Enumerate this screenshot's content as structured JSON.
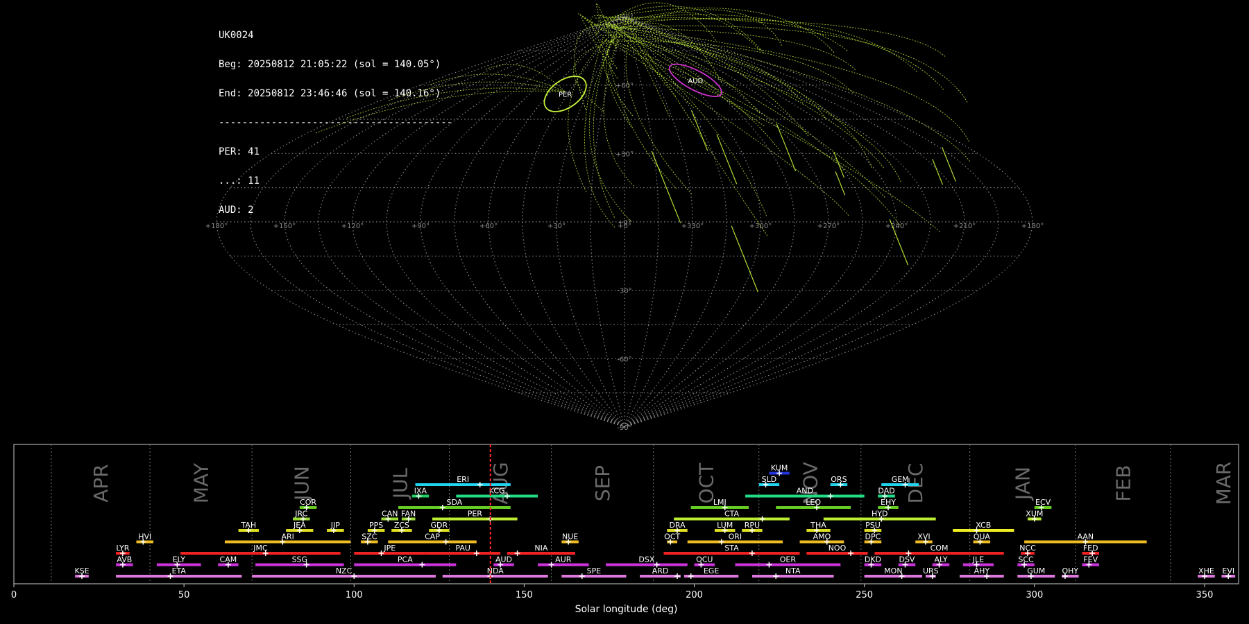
{
  "info": {
    "camera": "UK0024",
    "begin": "Beg: 20250812 21:05:22 (sol = 140.05°)",
    "end": "End: 20250812 23:46:46 (sol = 140.16°)",
    "separator": "----------------------------------------",
    "counts": [
      "PER: 41",
      "...: 11",
      "AUD: 2"
    ]
  },
  "colors": {
    "background": "#000000",
    "meteor_trail": "#c8f53c",
    "per_radiant": "#c8f53c",
    "aud_radiant": "#cc33cc",
    "grid": "#9a9a9a",
    "current_sol": "#ff2222"
  },
  "chart_data": [
    {
      "type": "scatter",
      "projection": "sinusoidal",
      "description_labels": {
        "lat_ticks": [
          "+90°",
          "+60°",
          "+30°",
          "+0°",
          "-30°",
          "-60°",
          "-90°"
        ],
        "lon_ticks": [
          "+180°",
          "+150°",
          "+120°",
          "+90°",
          "+60°",
          "+30°",
          "+0°",
          "+330°",
          "+300°",
          "+270°",
          "+240°",
          "+210°",
          "+180°"
        ]
      },
      "radiants": [
        {
          "name": "PER",
          "lon": 48,
          "lat": 57,
          "color": "#c8f53c",
          "count": 41
        },
        {
          "name": "AUD",
          "lon": 291,
          "lat": 63,
          "color": "#cc33cc",
          "count": 2
        }
      ],
      "trails_color": "#c8f53c",
      "grid": true
    },
    {
      "type": "gantt",
      "xlabel": "Solar longitude (deg)",
      "xlim": [
        0,
        360
      ],
      "xticks": [
        0,
        50,
        100,
        150,
        200,
        250,
        300,
        350
      ],
      "current_sol": 140.1,
      "months": [
        {
          "label": "APR",
          "start": 11
        },
        {
          "label": "MAY",
          "start": 40
        },
        {
          "label": "JUN",
          "start": 70
        },
        {
          "label": "JUL",
          "start": 99
        },
        {
          "label": "AUG",
          "start": 128
        },
        {
          "label": "SEP",
          "start": 158
        },
        {
          "label": "OCT",
          "start": 188
        },
        {
          "label": "NOV",
          "start": 219
        },
        {
          "label": "DEC",
          "start": 249
        },
        {
          "label": "JAN",
          "start": 281
        },
        {
          "label": "FEB",
          "start": 312
        },
        {
          "label": "MAR",
          "start": 340
        }
      ],
      "showers": [
        {
          "code": "KUM",
          "start": 222,
          "end": 228,
          "peak": 225,
          "row": 9,
          "color": "#2233dd"
        },
        {
          "code": "ERI",
          "start": 118,
          "end": 146,
          "peak": 137,
          "row": 8,
          "color": "#22d3ee"
        },
        {
          "code": "SLD",
          "start": 219,
          "end": 225,
          "peak": 221,
          "row": 8,
          "color": "#22d3ee"
        },
        {
          "code": "ORS",
          "start": 240,
          "end": 245,
          "peak": 243,
          "row": 8,
          "color": "#22d3ee"
        },
        {
          "code": "GEM",
          "start": 255,
          "end": 266,
          "peak": 262,
          "row": 8,
          "color": "#22d3ee"
        },
        {
          "code": "IXA",
          "start": 117,
          "end": 122,
          "peak": 119,
          "row": 7,
          "color": "#22cc66"
        },
        {
          "code": "KCG",
          "start": 130,
          "end": 154,
          "peak": 145,
          "row": 7,
          "color": "#22dd88"
        },
        {
          "code": "AND",
          "start": 215,
          "end": 250,
          "peak": 240,
          "row": 7,
          "color": "#22dd88"
        },
        {
          "code": "DAD",
          "start": 254,
          "end": 259,
          "peak": 256,
          "row": 7,
          "color": "#22dd88"
        },
        {
          "code": "COR",
          "start": 84,
          "end": 89,
          "peak": 86,
          "row": 6,
          "color": "#66cc22"
        },
        {
          "code": "SDA",
          "start": 113,
          "end": 146,
          "peak": 126,
          "row": 6,
          "color": "#66cc22"
        },
        {
          "code": "LMI",
          "start": 199,
          "end": 216,
          "peak": 209,
          "row": 6,
          "color": "#66cc22"
        },
        {
          "code": "LEO",
          "start": 224,
          "end": 246,
          "peak": 236,
          "row": 6,
          "color": "#66cc22"
        },
        {
          "code": "EHY",
          "start": 254,
          "end": 260,
          "peak": 257,
          "row": 6,
          "color": "#66cc22"
        },
        {
          "code": "ECV",
          "start": 300,
          "end": 305,
          "peak": 302,
          "row": 6,
          "color": "#66cc22"
        },
        {
          "code": "JRC",
          "start": 82,
          "end": 87,
          "peak": 85,
          "row": 5,
          "color": "#99dd33"
        },
        {
          "code": "CAN",
          "start": 108,
          "end": 113,
          "peak": 110,
          "row": 5,
          "color": "#99dd33"
        },
        {
          "code": "FAN",
          "start": 114,
          "end": 118,
          "peak": 116,
          "row": 5,
          "color": "#99dd33"
        },
        {
          "code": "PER",
          "start": 123,
          "end": 148,
          "peak": 140,
          "row": 5,
          "color": "#bbee33"
        },
        {
          "code": "CTA",
          "start": 194,
          "end": 228,
          "peak": 220,
          "row": 5,
          "color": "#bbee33"
        },
        {
          "code": "HYD",
          "start": 238,
          "end": 271,
          "peak": 255,
          "row": 5,
          "color": "#bbee33"
        },
        {
          "code": "XUM",
          "start": 298,
          "end": 302,
          "peak": 300,
          "row": 5,
          "color": "#bbee33"
        },
        {
          "code": "TAH",
          "start": 66,
          "end": 72,
          "peak": 69,
          "row": 4,
          "color": "#dddd22"
        },
        {
          "code": "JEA",
          "start": 80,
          "end": 88,
          "peak": 84,
          "row": 4,
          "color": "#dddd22"
        },
        {
          "code": "JIP",
          "start": 92,
          "end": 97,
          "peak": 94,
          "row": 4,
          "color": "#dddd22"
        },
        {
          "code": "PPS",
          "start": 104,
          "end": 109,
          "peak": 106,
          "row": 4,
          "color": "#dddd22"
        },
        {
          "code": "ZCS",
          "start": 111,
          "end": 117,
          "peak": 114,
          "row": 4,
          "color": "#dddd22"
        },
        {
          "code": "GDR",
          "start": 122,
          "end": 128,
          "peak": 125,
          "row": 4,
          "color": "#dddd22"
        },
        {
          "code": "DRA",
          "start": 192,
          "end": 198,
          "peak": 195,
          "row": 4,
          "color": "#dddd22"
        },
        {
          "code": "LUM",
          "start": 206,
          "end": 212,
          "peak": 209,
          "row": 4,
          "color": "#dddd22"
        },
        {
          "code": "RPU",
          "start": 214,
          "end": 220,
          "peak": 217,
          "row": 4,
          "color": "#dddd22"
        },
        {
          "code": "THA",
          "start": 233,
          "end": 240,
          "peak": 236,
          "row": 4,
          "color": "#dddd22"
        },
        {
          "code": "PSU",
          "start": 250,
          "end": 255,
          "peak": 253,
          "row": 4,
          "color": "#dddd22"
        },
        {
          "code": "XCB",
          "start": 276,
          "end": 294,
          "peak": 283,
          "row": 4,
          "color": "#eeee22"
        },
        {
          "code": "HVI",
          "start": 36,
          "end": 41,
          "peak": 38,
          "row": 3,
          "color": "#eebb22"
        },
        {
          "code": "ARI",
          "start": 62,
          "end": 99,
          "peak": 79,
          "row": 3,
          "color": "#eebb22"
        },
        {
          "code": "SZC",
          "start": 102,
          "end": 107,
          "peak": 104,
          "row": 3,
          "color": "#eebb22"
        },
        {
          "code": "CAP",
          "start": 110,
          "end": 136,
          "peak": 127,
          "row": 3,
          "color": "#eebb22"
        },
        {
          "code": "NUE",
          "start": 161,
          "end": 166,
          "peak": 163,
          "row": 3,
          "color": "#eebb22"
        },
        {
          "code": "OCT",
          "start": 192,
          "end": 195,
          "peak": 193,
          "row": 3,
          "color": "#eebb22"
        },
        {
          "code": "ORI",
          "start": 198,
          "end": 226,
          "peak": 208,
          "row": 3,
          "color": "#eebb22"
        },
        {
          "code": "AMO",
          "start": 231,
          "end": 244,
          "peak": 239,
          "row": 3,
          "color": "#eebb22"
        },
        {
          "code": "DPC",
          "start": 250,
          "end": 255,
          "peak": 252,
          "row": 3,
          "color": "#eebb22"
        },
        {
          "code": "XVI",
          "start": 265,
          "end": 270,
          "peak": 268,
          "row": 3,
          "color": "#eebb22"
        },
        {
          "code": "QUA",
          "start": 282,
          "end": 287,
          "peak": 284,
          "row": 3,
          "color": "#eebb22"
        },
        {
          "code": "AAN",
          "start": 297,
          "end": 333,
          "peak": 315,
          "row": 3,
          "color": "#eebb22"
        },
        {
          "code": "LYR",
          "start": 30,
          "end": 34,
          "peak": 32,
          "row": 2,
          "color": "#ee2222"
        },
        {
          "code": "JMC",
          "start": 49,
          "end": 96,
          "peak": 74,
          "row": 2,
          "color": "#ee2222"
        },
        {
          "code": "JPE",
          "start": 100,
          "end": 121,
          "peak": 108,
          "row": 2,
          "color": "#ee2222"
        },
        {
          "code": "PAU",
          "start": 121,
          "end": 143,
          "peak": 136,
          "row": 2,
          "color": "#ee2222"
        },
        {
          "code": "NIA",
          "start": 145,
          "end": 165,
          "peak": 148,
          "row": 2,
          "color": "#ee2222"
        },
        {
          "code": "STA",
          "start": 191,
          "end": 231,
          "peak": 217,
          "row": 2,
          "color": "#ee2222"
        },
        {
          "code": "NOO",
          "start": 233,
          "end": 251,
          "peak": 246,
          "row": 2,
          "color": "#ee2222"
        },
        {
          "code": "COM",
          "start": 253,
          "end": 291,
          "peak": 263,
          "row": 2,
          "color": "#ee2222"
        },
        {
          "code": "NCC",
          "start": 296,
          "end": 300,
          "peak": 298,
          "row": 2,
          "color": "#ee2222"
        },
        {
          "code": "FED",
          "start": 314,
          "end": 319,
          "peak": 317,
          "row": 2,
          "color": "#ee2222"
        },
        {
          "code": "AVB",
          "start": 30,
          "end": 35,
          "peak": 32,
          "row": 1,
          "color": "#cc33dd"
        },
        {
          "code": "ELY",
          "start": 42,
          "end": 55,
          "peak": 48,
          "row": 1,
          "color": "#cc33dd"
        },
        {
          "code": "CAM",
          "start": 60,
          "end": 66,
          "peak": 63,
          "row": 1,
          "color": "#cc33dd"
        },
        {
          "code": "SSG",
          "start": 71,
          "end": 97,
          "peak": 86,
          "row": 1,
          "color": "#cc33dd"
        },
        {
          "code": "PCA",
          "start": 100,
          "end": 130,
          "peak": 120,
          "row": 1,
          "color": "#cc33dd"
        },
        {
          "code": "AUD",
          "start": 141,
          "end": 147,
          "peak": 143,
          "row": 1,
          "color": "#cc33dd"
        },
        {
          "code": "AUR",
          "start": 154,
          "end": 169,
          "peak": 158,
          "row": 1,
          "color": "#cc33dd"
        },
        {
          "code": "DSX",
          "start": 174,
          "end": 198,
          "peak": 189,
          "row": 1,
          "color": "#cc33dd"
        },
        {
          "code": "OCU",
          "start": 200,
          "end": 206,
          "peak": 202,
          "row": 1,
          "color": "#cc33dd"
        },
        {
          "code": "OER",
          "start": 212,
          "end": 243,
          "peak": 222,
          "row": 1,
          "color": "#cc33dd"
        },
        {
          "code": "DKD",
          "start": 250,
          "end": 255,
          "peak": 252,
          "row": 1,
          "color": "#cc33dd"
        },
        {
          "code": "DSV",
          "start": 260,
          "end": 265,
          "peak": 262,
          "row": 1,
          "color": "#cc33dd"
        },
        {
          "code": "ALY",
          "start": 270,
          "end": 275,
          "peak": 272,
          "row": 1,
          "color": "#cc33dd"
        },
        {
          "code": "JLE",
          "start": 279,
          "end": 288,
          "peak": 283,
          "row": 1,
          "color": "#cc33dd"
        },
        {
          "code": "SCC",
          "start": 295,
          "end": 300,
          "peak": 297,
          "row": 1,
          "color": "#cc33dd"
        },
        {
          "code": "FEV",
          "start": 314,
          "end": 319,
          "peak": 316,
          "row": 1,
          "color": "#cc33dd"
        },
        {
          "code": "KSE",
          "start": 18,
          "end": 22,
          "peak": 20,
          "row": 0,
          "color": "#dd77dd"
        },
        {
          "code": "ETA",
          "start": 30,
          "end": 67,
          "peak": 46,
          "row": 0,
          "color": "#dd77dd"
        },
        {
          "code": "NZC",
          "start": 70,
          "end": 124,
          "peak": 100,
          "row": 0,
          "color": "#dd77dd"
        },
        {
          "code": "NDA",
          "start": 126,
          "end": 157,
          "peak": 140,
          "row": 0,
          "color": "#dd77dd"
        },
        {
          "code": "SPE",
          "start": 161,
          "end": 180,
          "peak": 167,
          "row": 0,
          "color": "#dd77dd"
        },
        {
          "code": "ARD",
          "start": 184,
          "end": 196,
          "peak": 195,
          "row": 0,
          "color": "#dd77dd"
        },
        {
          "code": "EGE",
          "start": 197,
          "end": 213,
          "peak": 199,
          "row": 0,
          "color": "#dd77dd"
        },
        {
          "code": "NTA",
          "start": 217,
          "end": 241,
          "peak": 224,
          "row": 0,
          "color": "#dd77dd"
        },
        {
          "code": "MON",
          "start": 250,
          "end": 267,
          "peak": 261,
          "row": 0,
          "color": "#dd77dd"
        },
        {
          "code": "URS",
          "start": 268,
          "end": 271,
          "peak": 270,
          "row": 0,
          "color": "#dd77dd"
        },
        {
          "code": "AHY",
          "start": 278,
          "end": 291,
          "peak": 286,
          "row": 0,
          "color": "#dd77dd"
        },
        {
          "code": "GUM",
          "start": 295,
          "end": 306,
          "peak": 299,
          "row": 0,
          "color": "#dd77dd"
        },
        {
          "code": "OHY",
          "start": 308,
          "end": 313,
          "peak": 309,
          "row": 0,
          "color": "#dd77dd"
        },
        {
          "code": "XHE",
          "start": 348,
          "end": 353,
          "peak": 350,
          "row": 0,
          "color": "#dd77dd"
        },
        {
          "code": "EVI",
          "start": 355,
          "end": 359,
          "peak": 357,
          "row": 0,
          "color": "#dd77dd"
        }
      ]
    }
  ]
}
